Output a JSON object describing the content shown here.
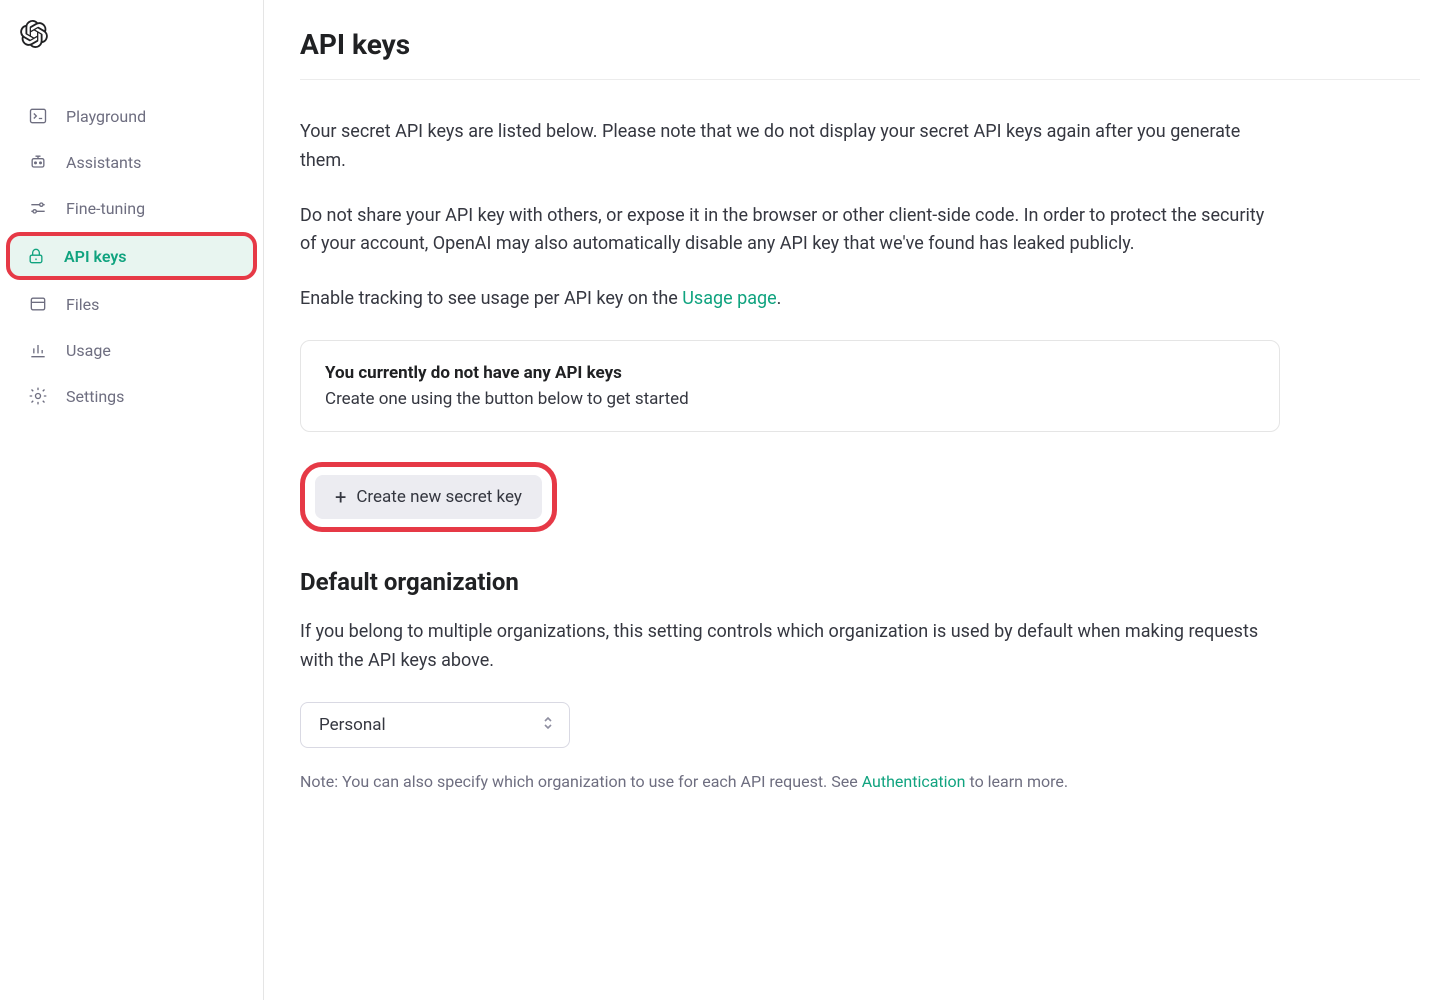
{
  "sidebar": {
    "items": [
      {
        "label": "Playground",
        "icon": "terminal"
      },
      {
        "label": "Assistants",
        "icon": "robot"
      },
      {
        "label": "Fine-tuning",
        "icon": "sliders"
      },
      {
        "label": "API keys",
        "icon": "lock"
      },
      {
        "label": "Files",
        "icon": "folder"
      },
      {
        "label": "Usage",
        "icon": "chart"
      },
      {
        "label": "Settings",
        "icon": "gear"
      }
    ]
  },
  "page": {
    "title": "API keys",
    "intro1": "Your secret API keys are listed below. Please note that we do not display your secret API keys again after you generate them.",
    "intro2": "Do not share your API key with others, or expose it in the browser or other client-side code. In order to protect the security of your account, OpenAI may also automatically disable any API key that we've found has leaked publicly.",
    "tracking_prefix": "Enable tracking to see usage per API key on the ",
    "tracking_link": "Usage page",
    "tracking_suffix": ".",
    "empty_title": "You currently do not have any API keys",
    "empty_sub": "Create one using the button below to get started",
    "create_button": "Create new secret key",
    "default_org_heading": "Default organization",
    "default_org_text": "If you belong to multiple organizations, this setting controls which organization is used by default when making requests with the API keys above.",
    "org_selected": "Personal",
    "note_prefix": "Note: You can also specify which organization to use for each API request. See ",
    "note_link": "Authentication",
    "note_suffix": " to learn more."
  }
}
